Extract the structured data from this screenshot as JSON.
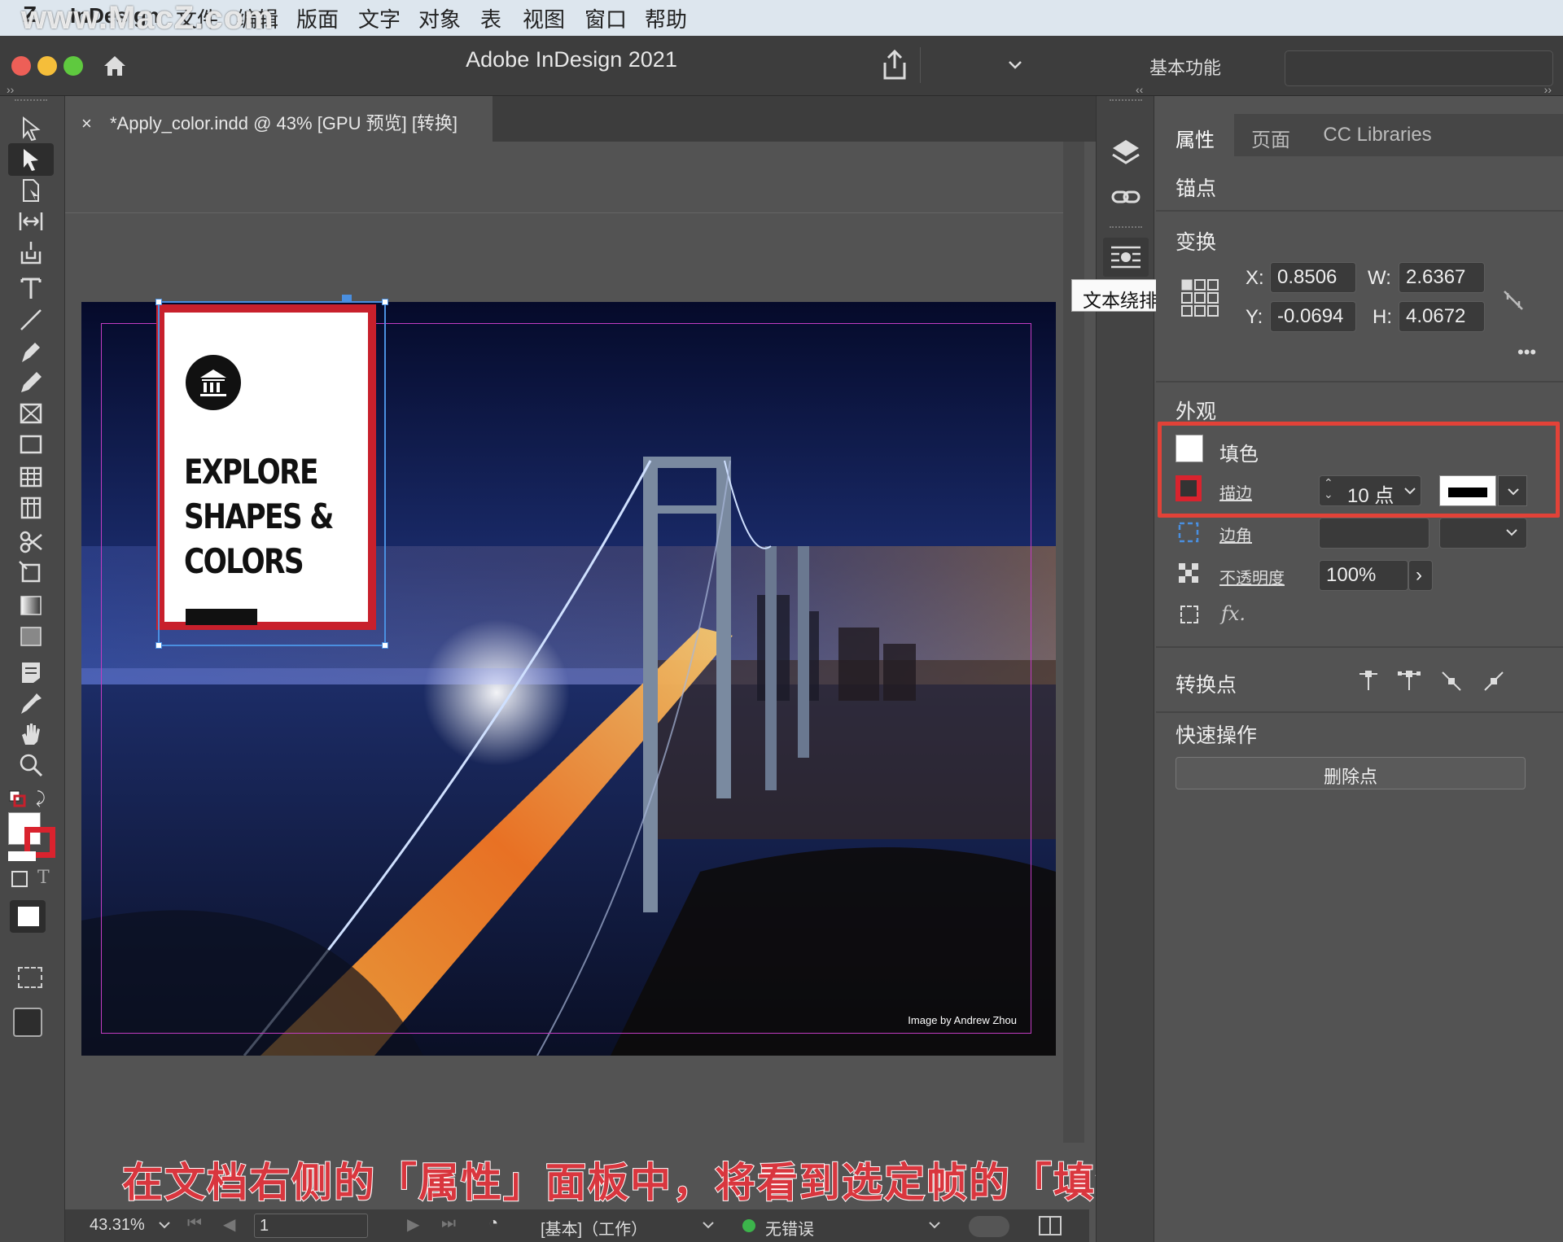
{
  "watermark": "www.MacZ.com",
  "menu": {
    "app": "InDesign",
    "items": [
      "文件",
      "编辑",
      "版面",
      "文字",
      "对象",
      "表",
      "视图",
      "窗口",
      "帮助"
    ]
  },
  "window": {
    "title": "Adobe InDesign 2021",
    "workspace": "基本功能"
  },
  "document_tab": {
    "close": "×",
    "label": "*Apply_color.indd @ 43% [GPU 预览] [转换]"
  },
  "artwork": {
    "card_title": "EXPLORE SHAPES & COLORS",
    "credit": "Image by Andrew Zhou"
  },
  "tooltip": "文本绕排",
  "panel": {
    "tabs": [
      "属性",
      "页面",
      "CC Libraries"
    ],
    "section_anchor": "锚点",
    "section_transform": "变换",
    "x_label": "X:",
    "x_value": "0.8506",
    "w_label": "W:",
    "w_value": "2.6367",
    "y_label": "Y:",
    "y_value": "-0.0694",
    "h_label": "H:",
    "h_value": "4.0672",
    "section_appearance": "外观",
    "fill_label": "填色",
    "stroke_label": "描边",
    "stroke_weight": "10 点",
    "corner_label": "边角",
    "opacity_label": "不透明度",
    "opacity_value": "100%",
    "fx_label": "fx.",
    "section_convert": "转换点",
    "section_quick": "快速操作",
    "delete_point_button": "删除点"
  },
  "status": {
    "zoom": "43.31%",
    "page": "1",
    "profile": "[基本]（工作）",
    "errors": "无错误"
  },
  "subtitle": "在文档右侧的「属性」面板中，将看到选定帧的「填色」和「描边」",
  "colors": {
    "accent_red": "#e24238",
    "stroke_red": "#c8202c",
    "selection_blue": "#4a8fe0",
    "no_error_green": "#3cb44b"
  }
}
